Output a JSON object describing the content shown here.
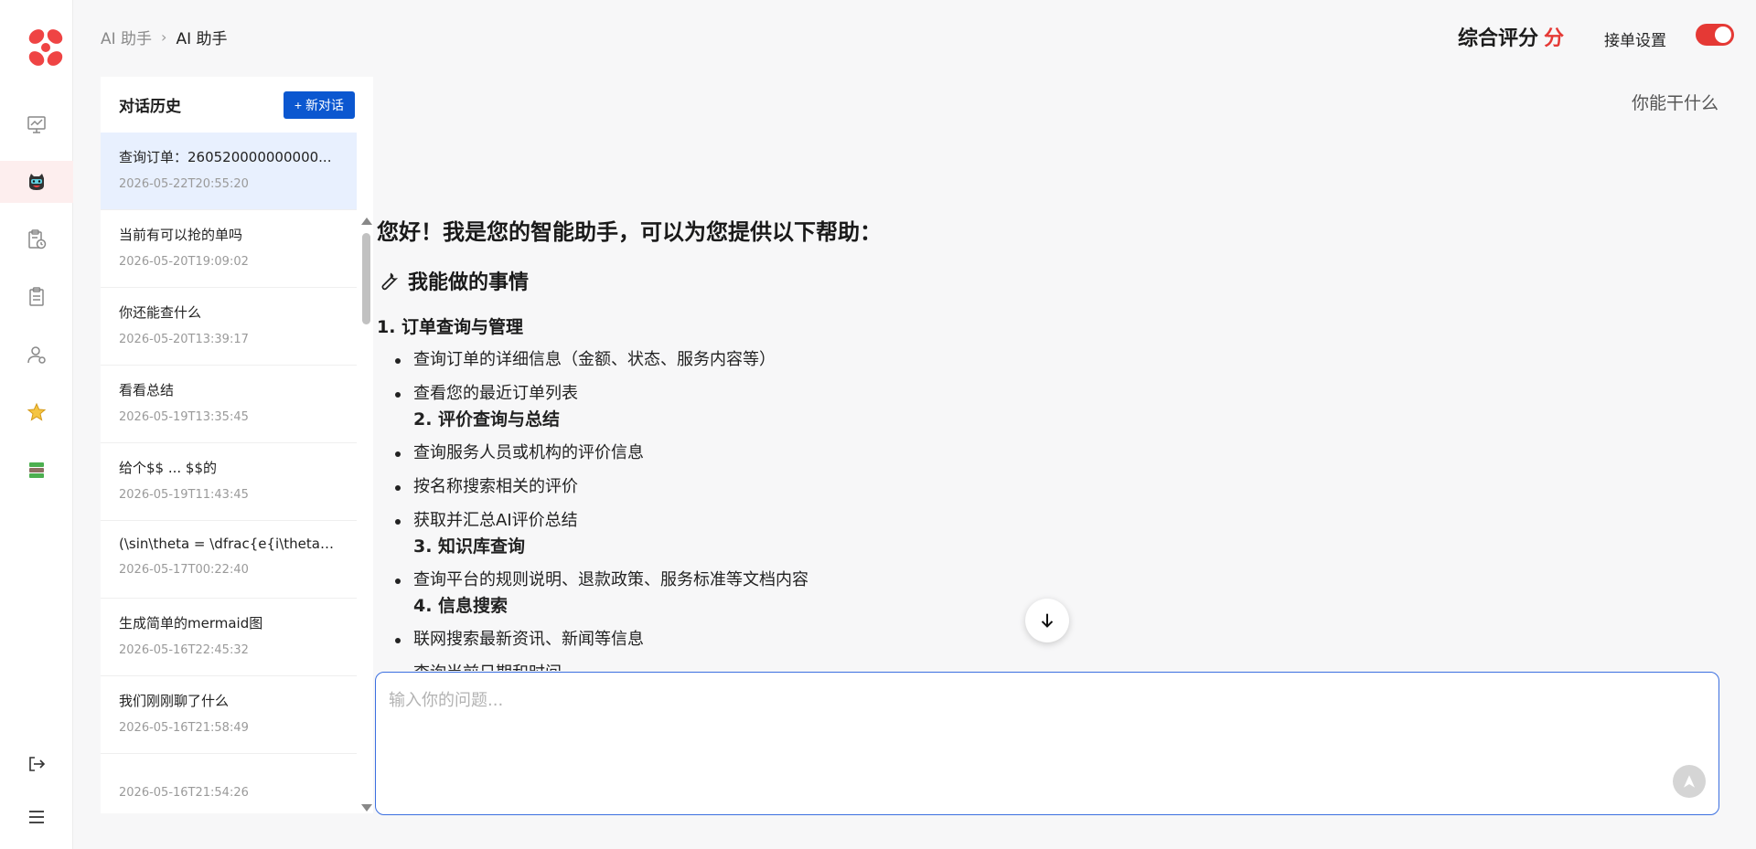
{
  "header": {
    "breadcrumb_parent": "AI 助手",
    "breadcrumb_current": "AI 助手",
    "score_label": "综合评分",
    "score_unit": "分",
    "order_setting_label": "接单设置",
    "order_toggle_on": true
  },
  "nav": {
    "icons": [
      "dashboard-chart-icon",
      "ai-assistant-icon",
      "order-clock-icon",
      "clipboard-icon",
      "user-settings-icon",
      "star-icon",
      "database-icon"
    ],
    "active": "ai-assistant-icon",
    "bottom_icons": [
      "logout-icon",
      "menu-icon"
    ]
  },
  "history": {
    "title": "对话历史",
    "new_button": "+ 新对话",
    "items": [
      {
        "title": "查询订单：260520000000000...",
        "time": "2026-05-22T20:55:20"
      },
      {
        "title": "当前有可以抢的单吗",
        "time": "2026-05-20T19:09:02"
      },
      {
        "title": "你还能查什么",
        "time": "2026-05-20T13:39:17"
      },
      {
        "title": "看看总结",
        "time": "2026-05-19T13:35:45"
      },
      {
        "title": "给个$$ ... $$的",
        "time": "2026-05-19T11:43:45"
      },
      {
        "title": "(\\sin\\theta = \\dfrac{e{i\\theta}...",
        "time": "2026-05-17T00:22:40"
      },
      {
        "title": "生成简单的mermaid图",
        "time": "2026-05-16T22:45:32"
      },
      {
        "title": "我们刚刚聊了什么",
        "time": "2026-05-16T21:58:49"
      },
      {
        "title": "",
        "time": "2026-05-16T21:54:26"
      }
    ]
  },
  "chat": {
    "user_message": "你能干什么",
    "greeting": "您好！我是您的智能助手，可以为您提供以下帮助：",
    "section_title": "我能做的事情",
    "groups": [
      {
        "title": "1. 订单查询与管理"
      }
    ],
    "bullets": {
      "b1": "查询订单的详细信息（金额、状态、服务内容等）",
      "b2": "查看您的最近订单列表",
      "b2_sub": "2. 评价查询与总结",
      "b3": "查询服务人员或机构的评价信息",
      "b4": "按名称搜索相关的评价",
      "b5": "获取并汇总AI评价总结",
      "b5_sub": "3. 知识库查询",
      "b6": "查询平台的规则说明、退款政策、服务标准等文档内容",
      "b6_sub": "4. 信息搜索",
      "b7": "联网搜索最新资讯、新闻等信息",
      "b8": "查询当前日期和时间"
    }
  },
  "input": {
    "placeholder": "输入你的问题...",
    "value": ""
  }
}
